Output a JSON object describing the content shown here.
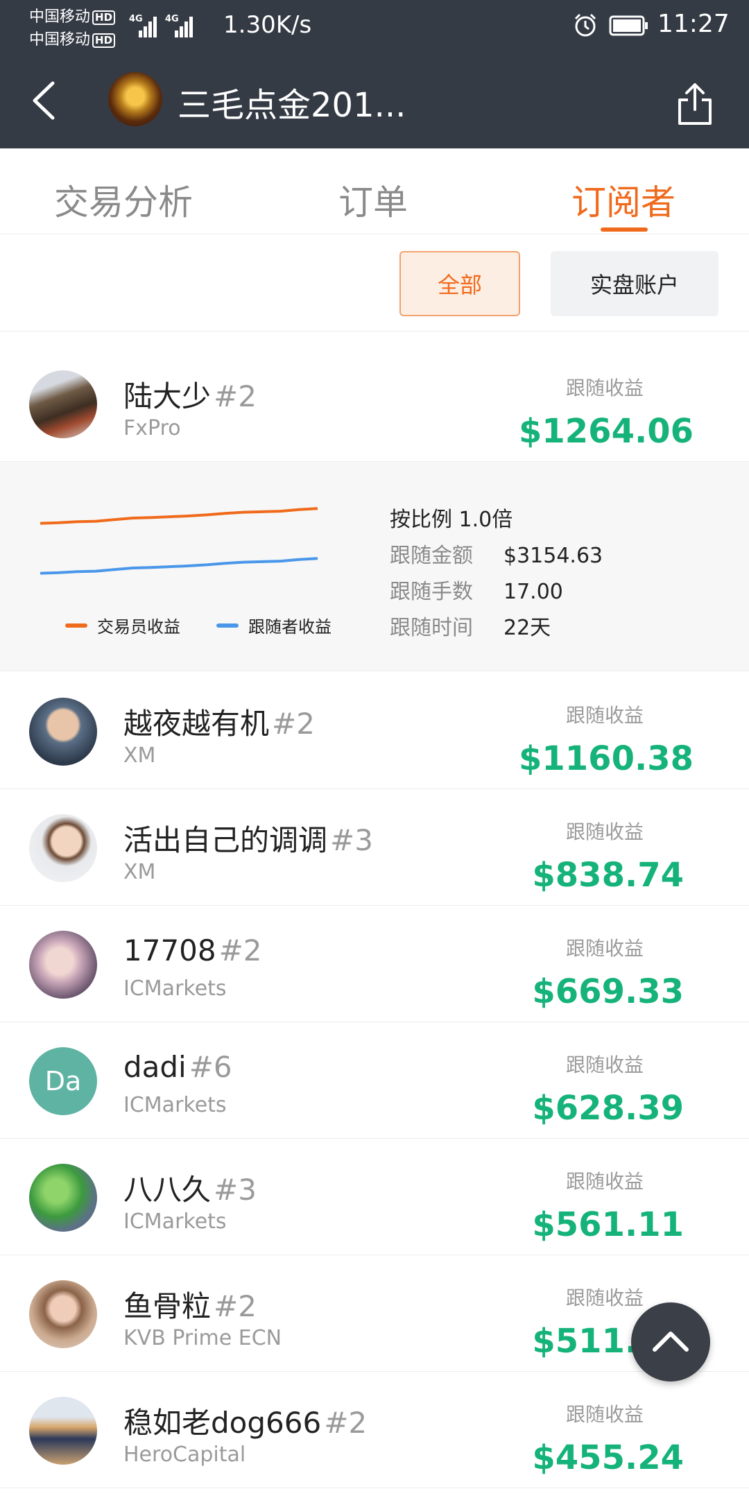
{
  "status_bar": {
    "carrier_1": "中国移动",
    "carrier_2": "中国移动",
    "hd": "HD",
    "net": "4G",
    "speed": "1.30K/s",
    "time": "11:27"
  },
  "header": {
    "title": "三毛点金201...",
    "back_icon": "chevron-left-icon",
    "share_icon": "share-icon"
  },
  "tabs": [
    {
      "label": "交易分析",
      "active": false
    },
    {
      "label": "订单",
      "active": false
    },
    {
      "label": "订阅者",
      "active": true
    }
  ],
  "filters": {
    "all": "全部",
    "live": "实盘账户"
  },
  "profit_label": "跟随收益",
  "subscribers": [
    {
      "name": "陆大少",
      "rank": "#2",
      "broker": "FxPro",
      "profit": "$1264.06"
    },
    {
      "name": "越夜越有机",
      "rank": "#2",
      "broker": "XM",
      "profit": "$1160.38"
    },
    {
      "name": "活出自己的调调",
      "rank": "#3",
      "broker": "XM",
      "profit": "$838.74"
    },
    {
      "name": "17708",
      "rank": "#2",
      "broker": "ICMarkets",
      "profit": "$669.33"
    },
    {
      "name": "dadi",
      "rank": "#6",
      "broker": "ICMarkets",
      "profit": "$628.39",
      "initials": "Da"
    },
    {
      "name": "八八久",
      "rank": "#3",
      "broker": "ICMarkets",
      "profit": "$561.11"
    },
    {
      "name": "鱼骨粒",
      "rank": "#2",
      "broker": "KVB Prime ECN",
      "profit": "$511.23"
    },
    {
      "name": "稳如老dog666",
      "rank": "#2",
      "broker": "HeroCapital",
      "profit": "$455.24"
    }
  ],
  "detail": {
    "ratio": "按比例 1.0倍",
    "amount_label": "跟随金额",
    "amount": "$3154.63",
    "lots_label": "跟随手数",
    "lots": "17.00",
    "time_label": "跟随时间",
    "time": "22天",
    "legend_trader": "交易员收益",
    "legend_follower": "跟随者收益",
    "colors": {
      "trader": "#f06a1c",
      "follower": "#4a97ea"
    }
  },
  "chart_data": {
    "type": "line",
    "series": [
      {
        "name": "交易员收益",
        "values": [
          0.3,
          0.32,
          0.36,
          0.38,
          0.44,
          0.5,
          0.52,
          0.55,
          0.58,
          0.62,
          0.68,
          0.72,
          0.74,
          0.76,
          0.82,
          0.86
        ]
      },
      {
        "name": "跟随者收益",
        "values": [
          0.3,
          0.32,
          0.36,
          0.38,
          0.44,
          0.5,
          0.52,
          0.55,
          0.58,
          0.62,
          0.68,
          0.72,
          0.74,
          0.76,
          0.82,
          0.86
        ]
      }
    ],
    "title": "",
    "xlabel": "",
    "ylabel": ""
  },
  "scroll_top_icon": "chevron-up-icon"
}
